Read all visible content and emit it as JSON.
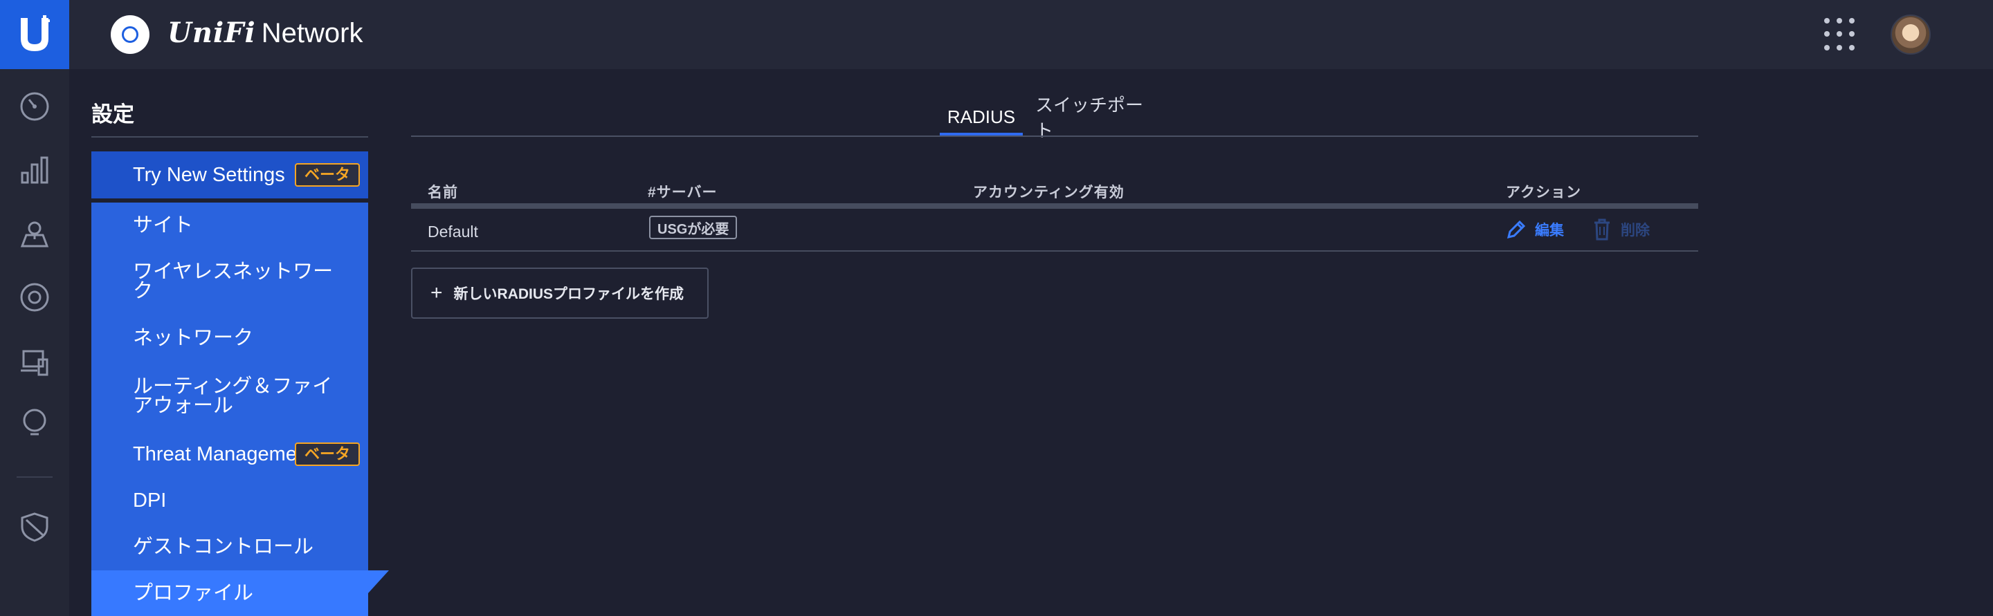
{
  "app": {
    "brand_unifi": "UniFi",
    "brand_network": "Network",
    "accent": "#1d5fe0"
  },
  "rail": {
    "items": [
      {
        "icon": "dashboard-icon"
      },
      {
        "icon": "statistics-icon"
      },
      {
        "icon": "map-icon"
      },
      {
        "icon": "devices-icon"
      },
      {
        "icon": "clients-icon"
      },
      {
        "icon": "insights-icon"
      },
      {
        "icon": "threat-shield-icon"
      }
    ]
  },
  "sidebar": {
    "title": "設定",
    "items": [
      {
        "label": "Try New Settings",
        "badge": "ベータ"
      },
      {
        "label": "サイト"
      },
      {
        "label": "ワイヤレスネットワーク"
      },
      {
        "label": "ネットワーク"
      },
      {
        "label": "ルーティング＆ファイアウォール"
      },
      {
        "label": "Threat Management",
        "badge": "ベータ"
      },
      {
        "label": "DPI"
      },
      {
        "label": "ゲストコントロール"
      },
      {
        "label": "プロファイル"
      }
    ]
  },
  "tabs": [
    {
      "label": "RADIUS",
      "active": true
    },
    {
      "label": "スイッチポート",
      "active": false
    }
  ],
  "table": {
    "headers": [
      "名前",
      "#サーバー",
      "アカウンティング有効",
      "アクション"
    ],
    "rows": [
      {
        "name": "Default",
        "servers_badge": "USGが必要",
        "edit": "編集",
        "delete": "削除"
      }
    ]
  },
  "create_button": "新しいRADIUSプロファイルを作成"
}
